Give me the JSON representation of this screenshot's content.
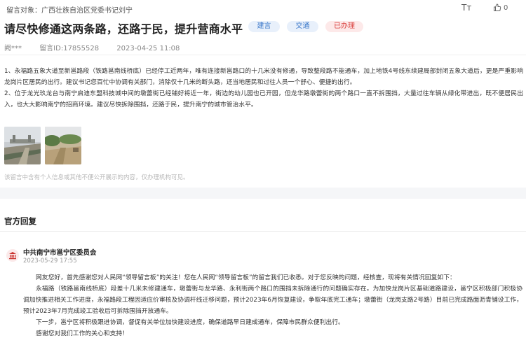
{
  "header": {
    "recipient": "留言对象：广西壮族自治区党委书记刘宁",
    "font_size_label": "Tт",
    "like_count": "0"
  },
  "message": {
    "title": "请尽快修通这两条路，还路于民，提升营商水平",
    "tags": [
      "建言",
      "交通",
      "已办理"
    ],
    "author": "阙***",
    "message_id": "留言ID:17855528",
    "date": "2023-04-25 11:08",
    "paragraphs": [
      "1、永福路五象大道至新邕路段（铁路邕南线桥底）已经停工近两年，唯有连接新邕路口的十几米没有修通，导致整段路不能通车，加上地铁4号线东续建局部封闭五象大道后，更是严重影响龙岗片区居民的出行。建议书记您百忙中协调有关部门，消除仅十几米的断头路，还当地居民和过往人员一个舒心、便捷的出行。",
      "2、位于龙光玖龙台与南宁启迪东盟科技城中间的墩蕾街已经铺好将近一年，街边的幼儿园也已开园，但龙华路墩蕾街的两个路口一直不拆围挡，大量过往车辆从绿化带进出，既不便居民出入，也大大影响南宁的招商环境。建议尽快拆除围挡，还路于民，提升南宁的城市管治水平。"
    ],
    "disclaimer": "该留言中含有个人信息或其他不便公开展示的内容，仅办理机构可见。"
  },
  "reply": {
    "section_title": "官方回复",
    "org": "中共南宁市邕宁区委员会",
    "date": "2023-05-29 17:55",
    "paragraphs": [
      "网友您好，首先感谢您对人民网“领导留言板”的关注！您在人民网“领导留言板”的留言我们已收悉。对于您反映的问题，经核查，现将有关情况回复如下：",
      "永福路（铁路邕南线桥底）段差十几米未修建通车，墩蕾街与龙华路、永利街两个路口的围挡未拆除通行的问题确实存在。为加快龙岗片区基础道路建设，邕宁区积极部门积极协调加快推进相关工作进度，永福路段工程因适应价审核及协调杆线迁移问题，预计2023年6月恢复建设，争取年底完工通车；墩蕾街（龙岗支路2号路）目前已完成路面沥青铺设工作，预计2023年7月完成竣工验收后可拆除围挡开放通车。",
      "下一步，邕宁区将积极跟进协调，督促有关单位加快建设进度，确保道路早日建成通车，保障市民群众便利出行。",
      "感谢您对我们工作的关心和支持！"
    ]
  },
  "icons": {
    "font_size": "font-size-icon",
    "like": "thumbs-up-icon",
    "org_logo": "government-building-icon"
  },
  "colors": {
    "tag_blue": "#3a77c9",
    "tag_red": "#d9403d",
    "logo_red": "#c9302c"
  }
}
